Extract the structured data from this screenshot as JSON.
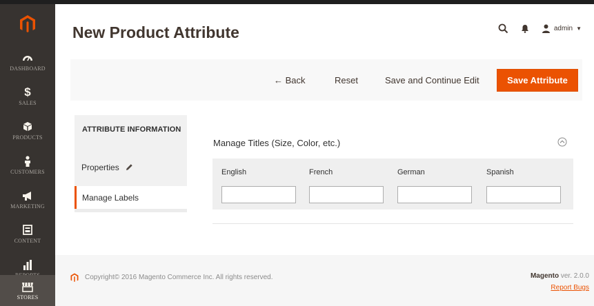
{
  "sidebar": {
    "logo_icon": "magento-logo-icon",
    "items": [
      {
        "label": "DASHBOARD",
        "icon": "speedometer-icon"
      },
      {
        "label": "SALES",
        "icon": "dollar-icon"
      },
      {
        "label": "PRODUCTS",
        "icon": "cube-icon"
      },
      {
        "label": "CUSTOMERS",
        "icon": "person-icon"
      },
      {
        "label": "MARKETING",
        "icon": "megaphone-icon"
      },
      {
        "label": "CONTENT",
        "icon": "layout-icon"
      },
      {
        "label": "REPORTS",
        "icon": "bar-chart-icon"
      },
      {
        "label": "STORES",
        "icon": "store-icon"
      }
    ]
  },
  "header": {
    "title": "New Product Attribute",
    "user": "admin",
    "icons": [
      "search-icon",
      "bell-icon",
      "user-icon",
      "caret-down-icon"
    ]
  },
  "page_actions": {
    "back": "← Back",
    "reset": "Reset",
    "save_continue": "Save and Continue Edit",
    "save": "Save Attribute"
  },
  "tabs": {
    "heading": "ATTRIBUTE INFORMATION",
    "items": [
      "Properties",
      "Manage Labels"
    ],
    "active": "Manage Labels"
  },
  "section": {
    "title": "Manage Titles (Size, Color, etc.)",
    "columns": [
      {
        "header": "English",
        "value": ""
      },
      {
        "header": "French",
        "value": ""
      },
      {
        "header": "German",
        "value": ""
      },
      {
        "header": "Spanish",
        "value": ""
      }
    ]
  },
  "footer": {
    "copyright": "Copyright© 2016 Magento Commerce Inc. All rights reserved.",
    "brand": "Magento",
    "version": "ver. 2.0.0",
    "report_bugs": "Report Bugs"
  },
  "colors": {
    "accent": "#eb5202",
    "sidebar": "#373330",
    "text": "#41362f"
  }
}
